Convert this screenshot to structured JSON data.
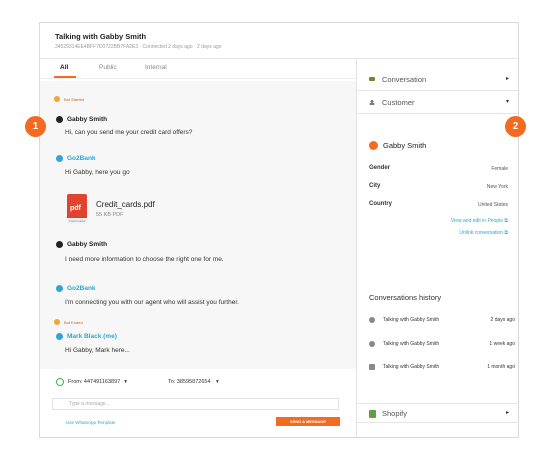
{
  "header": {
    "title": "Talking with Gabby Smith",
    "subtitle": "34529314EE4BFF7D0722BB7FA2E3 · Connected 2 days ago · 2 days ago"
  },
  "tabs": [
    {
      "label": "All",
      "active": true
    },
    {
      "label": "Public",
      "active": false
    },
    {
      "label": "Internal",
      "active": false
    }
  ],
  "chat": {
    "bot_started": "Bot Started",
    "bot_ended": "Bot Ended",
    "messages": [
      {
        "author": "Gabby Smith",
        "text": "Hi, can you send me your credit card offers?"
      },
      {
        "author": "Go2Bank",
        "text": "Hi Gabby, here you go"
      },
      {
        "author": "Gabby Smith",
        "text": "I need more information to choose the right one for me."
      },
      {
        "author": "Go2Bank",
        "text": "I'm connecting you with our agent who will assist you further."
      },
      {
        "author": "Mark Black (me)",
        "text": "Hi Gabby, Mark here..."
      }
    ],
    "attachment": {
      "name": "Credit_cards.pdf",
      "meta": "55 KB PDF",
      "icon_label": "pdf",
      "icon_footer": "Credit Cards"
    }
  },
  "badges": [
    "1",
    "2"
  ],
  "compose": {
    "from": "From: 447491163897",
    "to": "To: 38595872654",
    "caret": "▾",
    "placeholder": "Type a message...",
    "template_link": "Use WhatsApp Template",
    "send_label": "SEND A MESSAGE"
  },
  "sidebar": {
    "conversation_label": "Conversation",
    "customer_label": "Customer",
    "chev_right": "▸",
    "chev_down": "▾",
    "customer": {
      "name": "Gabby Smith",
      "fields": [
        {
          "key": "Gender",
          "value": "Female"
        },
        {
          "key": "City",
          "value": "New York"
        },
        {
          "key": "Country",
          "value": "United States"
        }
      ],
      "view_link": "View and edit in People ⧉",
      "unlink": "Unlink conversation ⧉"
    },
    "history_title": "Conversations history",
    "history": [
      {
        "title": "Talking with Gabby Smith",
        "when": "2 days ago"
      },
      {
        "title": "Talking with Gabby Smith",
        "when": "1 week ago"
      },
      {
        "title": "Talking with Gabby Smith",
        "when": "1 month ago"
      }
    ],
    "shopify_label": "Shopify"
  },
  "colors": {
    "accent": "#f26b21",
    "link": "#2ea6d8",
    "whatsapp": "#3bb54a"
  }
}
